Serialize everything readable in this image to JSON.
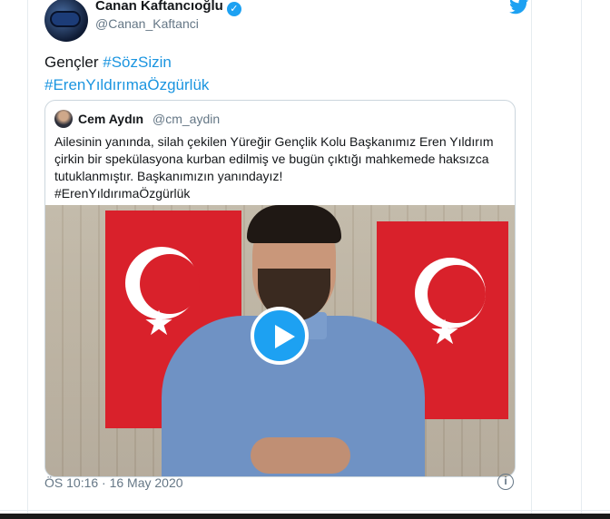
{
  "author": {
    "name": "Canan Kaftancıoğlu",
    "handle": "@Canan_Kaftanci",
    "verified_icon": "verified-badge-icon"
  },
  "tweet": {
    "text_plain": "Gençler",
    "hashtag1": "#SözSizin",
    "hashtag2": "#ErenYıldırımaÖzgürlük"
  },
  "quoted": {
    "name": "Cem Aydın",
    "handle": "@cm_aydin",
    "text": "Ailesinin yanında, silah çekilen Yüreğir Gençlik Kolu Başkanımız Eren Yıldırım çirkin bir spekülasyona kurban edilmiş ve bugün çıktığı mahkemede haksızca tutuklanmıştır. Başkanımızın yanındayız!",
    "hashtag": "#ErenYıldırımaÖzgürlük"
  },
  "meta": {
    "timestamp": "ÖS 10:16 · 16 May 2020"
  },
  "colors": {
    "accent": "#1da1f2",
    "hashtag": "#1b95e0",
    "muted": "#657786",
    "flag_red": "#d9212b"
  },
  "icons": {
    "twitter": "twitter-bird-icon",
    "play": "play-icon",
    "info": "info-icon"
  }
}
